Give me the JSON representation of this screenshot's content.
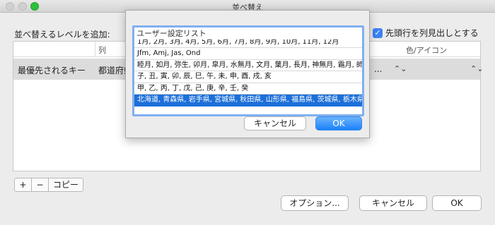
{
  "window": {
    "title": "並べ替え"
  },
  "toolbar": {
    "add_level_label": "並べ替えるレベルを追加:",
    "header_row_check": "✓",
    "header_row_label": "先頭行を列見出しとする"
  },
  "columns": {
    "column": "列",
    "color_icon": "色/アイコン"
  },
  "sort_row": {
    "priority_label": "最優先されるキー",
    "column_value": "都道府県",
    "order_value": "...",
    "stepper_1": "⌃⌄",
    "stepper_2": "⌃⌄"
  },
  "bottom_controls": {
    "add": "+",
    "remove": "−",
    "copy": "コピー"
  },
  "buttons": {
    "options": "オプション...",
    "cancel": "キャンセル",
    "ok": "OK"
  },
  "popup": {
    "list_title": "ユーザー設定リスト",
    "items": [
      "1月, 2月, 3月, 4月, 5月, 6月, 7月, 8月, 9月, 10月, 11月, 12月",
      "Jfm, Amj, Jas, Ond",
      "睦月, 如月, 弥生, 卯月, 皐月, 水無月, 文月, 葉月, 長月, 神無月, 霜月, 師走",
      "子, 丑, 寅, 卯, 辰, 巳, 午, 未, 申, 酉, 戌, 亥",
      "甲, 乙, 丙, 丁, 戊, 己, 庚, 辛, 壬, 癸",
      "北海道, 青森県, 岩手県, 宮城県, 秋田県, 山形県, 福島県, 茨城県, 栃木県"
    ],
    "cancel": "キャンセル",
    "ok": "OK"
  }
}
